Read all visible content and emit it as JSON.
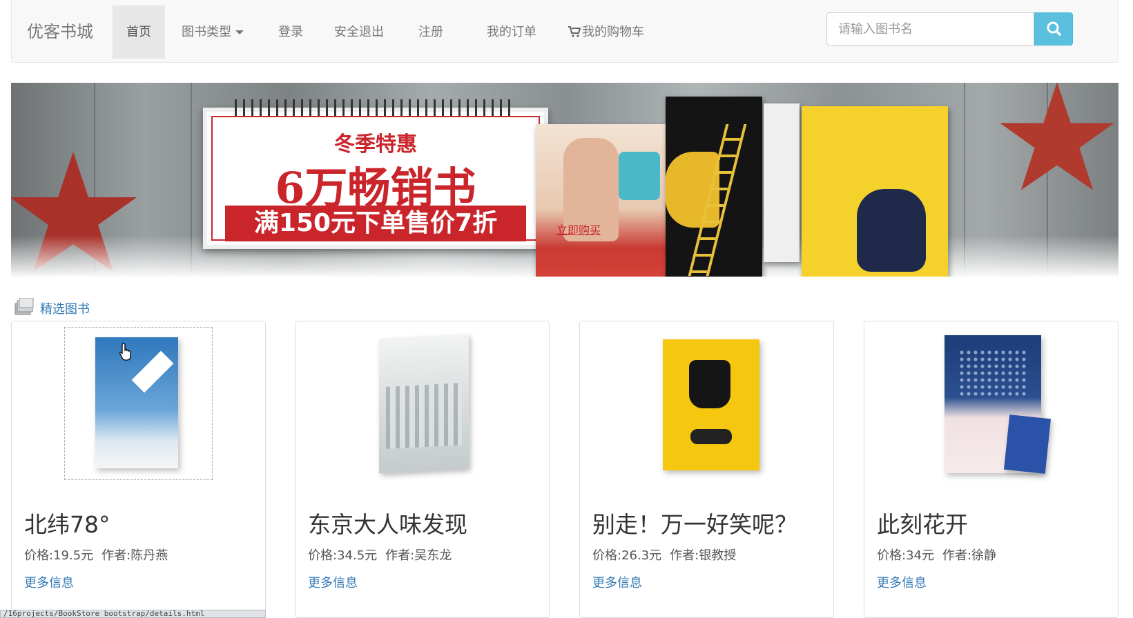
{
  "navbar": {
    "brand": "优客书城",
    "items": [
      {
        "label": "首页",
        "active": true
      },
      {
        "label": "图书类型",
        "dropdown": true
      },
      {
        "label": "登录"
      },
      {
        "label": "安全退出"
      },
      {
        "label": "注册"
      },
      {
        "label": "我的订单"
      },
      {
        "label": "我的购物车",
        "icon": "cart-icon"
      }
    ],
    "search": {
      "placeholder": "请输入图书名",
      "button_icon": "search-icon"
    }
  },
  "banner": {
    "headline": "冬季特惠",
    "big_text": "6万畅销书",
    "offer": "满150元下单售价7折",
    "buy_link": "立即购买"
  },
  "featured": {
    "title": "精选图书",
    "icon": "books-icon",
    "books": [
      {
        "title": "北纬78°",
        "price": "价格:19.5元",
        "author": "作者:陈丹燕",
        "more": "更多信息",
        "cover_color": "#3f86c6"
      },
      {
        "title": "东京大人味发现",
        "price": "价格:34.5元",
        "author": "作者:吴东龙",
        "more": "更多信息",
        "cover_color": "#e9ecec"
      },
      {
        "title": "别走！万一好笑呢？",
        "price": "价格:26.3元",
        "author": "作者:银教授",
        "more": "更多信息",
        "cover_color": "#f5c80f"
      },
      {
        "title": "此刻花开",
        "price": "价格:34元",
        "author": "作者:徐静",
        "more": "更多信息",
        "cover_color": "#1d3c78"
      }
    ]
  },
  "status_url": "/16projects/BookStore_bootstrap/details.html"
}
